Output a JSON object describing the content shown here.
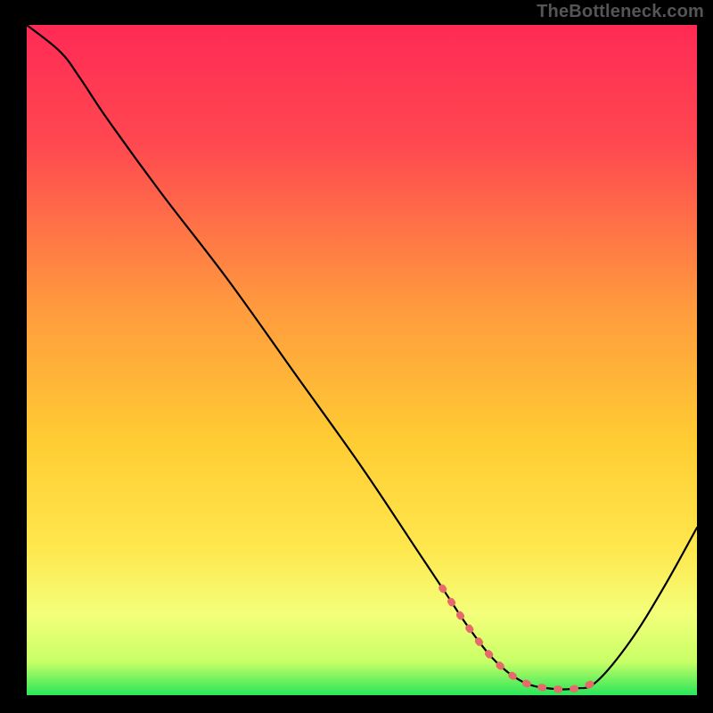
{
  "watermark": "TheBottleneck.com",
  "colors": {
    "gradient_top": "#ff2a55",
    "gradient_mid": "#ffcc33",
    "gradient_low": "#f6ff8a",
    "gradient_bottom": "#28e65a",
    "curve": "#000000",
    "highlight": "#e66a6a",
    "background": "#000000"
  },
  "chart_data": {
    "type": "line",
    "title": "",
    "xlabel": "",
    "ylabel": "",
    "xlim": [
      0,
      100
    ],
    "ylim": [
      0,
      100
    ],
    "series": [
      {
        "name": "bottleneck-curve",
        "x": [
          0,
          5,
          8,
          12,
          20,
          30,
          40,
          50,
          58,
          62,
          66,
          70,
          74,
          78,
          82,
          85,
          90,
          95,
          100
        ],
        "y": [
          100,
          96,
          92,
          86,
          75,
          62,
          48,
          34,
          22,
          16,
          10,
          5,
          2,
          1,
          1,
          2,
          8,
          16,
          25
        ]
      },
      {
        "name": "optimal-range-highlight",
        "x": [
          62,
          66,
          70,
          74,
          78,
          82,
          85
        ],
        "y": [
          16,
          10,
          5,
          2,
          1,
          1,
          2
        ]
      }
    ]
  }
}
